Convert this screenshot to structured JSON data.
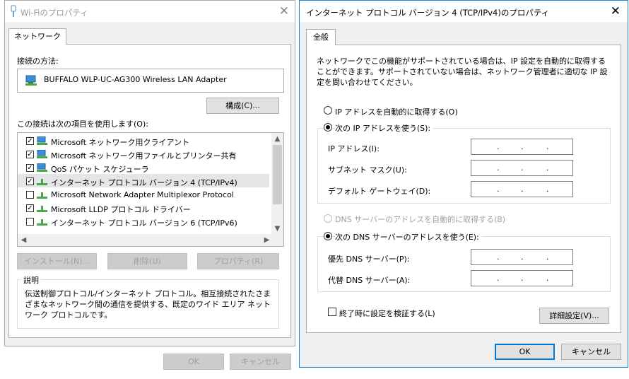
{
  "wifi_dialog": {
    "title": "Wi-Fiのプロパティ",
    "tab": "ネットワーク",
    "connect_using_label": "接続の方法:",
    "adapter_name": "BUFFALO WLP-UC-AG300 Wireless LAN Adapter",
    "configure_button": "構成(C)...",
    "items_label": "この接続は次の項目を使用します(O):",
    "items": [
      {
        "label": "Microsoft ネットワーク用クライアント",
        "checked": true
      },
      {
        "label": "Microsoft ネットワーク用ファイルとプリンター共有",
        "checked": true
      },
      {
        "label": "QoS パケット スケジューラ",
        "checked": true
      },
      {
        "label": "インターネット プロトコル バージョン 4 (TCP/IPv4)",
        "checked": true
      },
      {
        "label": "Microsoft Network Adapter Multiplexor Protocol",
        "checked": false
      },
      {
        "label": "Microsoft LLDP プロトコル ドライバー",
        "checked": true
      },
      {
        "label": "インターネット プロトコル バージョン 6 (TCP/IPv6)",
        "checked": false
      }
    ],
    "install_button": "インストール(N)...",
    "uninstall_button": "削除(U)",
    "properties_button": "プロパティ(R)",
    "description_legend": "説明",
    "description_text": "伝送制御プロトコル/インターネット プロトコル。相互接続されたさまざまなネットワーク間の通信を提供する、既定のワイド エリア ネットワーク プロトコルです。",
    "ok_button": "OK",
    "cancel_button": "キャンセル"
  },
  "ipv4_dialog": {
    "title": "インターネット プロトコル バージョン 4 (TCP/IPv4)のプロパティ",
    "tab": "全般",
    "intro_text": "ネットワークでこの機能がサポートされている場合は、IP 設定を自動的に取得することができます。サポートされていない場合は、ネットワーク管理者に適切な IP 設定を問い合わせてください。",
    "ip_auto_label": "IP アドレスを自動的に取得する(O)",
    "ip_manual_label": "次の IP アドレスを使う(S):",
    "ip_address_label": "IP アドレス(I):",
    "subnet_label": "サブネット マスク(U):",
    "gateway_label": "デフォルト ゲートウェイ(D):",
    "dns_auto_label": "DNS サーバーのアドレスを自動的に取得する(B)",
    "dns_manual_label": "次の DNS サーバーのアドレスを使う(E):",
    "preferred_dns_label": "優先 DNS サーバー(P):",
    "alternate_dns_label": "代替 DNS サーバー(A):",
    "validate_label": "終了時に設定を検証する(L)",
    "advanced_button": "詳細設定(V)...",
    "ok_button": "OK",
    "cancel_button": "キャンセル"
  }
}
